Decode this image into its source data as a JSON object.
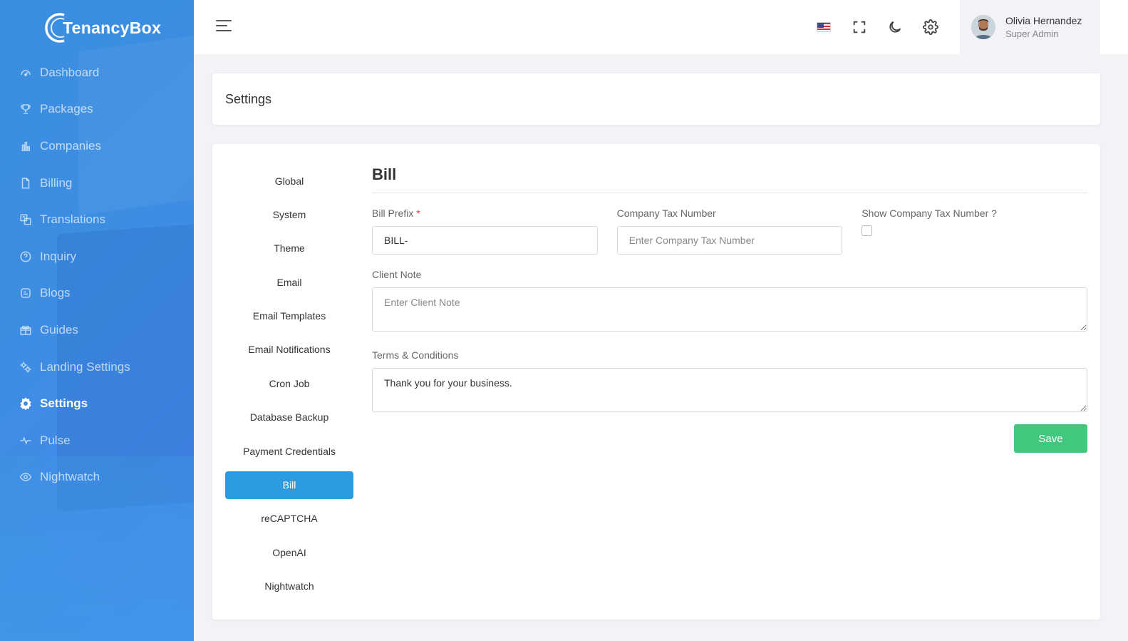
{
  "app": {
    "name": "TenancyBox"
  },
  "sidebar": {
    "items": [
      {
        "label": "Dashboard",
        "icon": "dashboard-icon"
      },
      {
        "label": "Packages",
        "icon": "trophy-icon"
      },
      {
        "label": "Companies",
        "icon": "bar-chart-icon"
      },
      {
        "label": "Billing",
        "icon": "file-icon"
      },
      {
        "label": "Translations",
        "icon": "translate-icon"
      },
      {
        "label": "Inquiry",
        "icon": "question-icon"
      },
      {
        "label": "Blogs",
        "icon": "blog-icon"
      },
      {
        "label": "Guides",
        "icon": "gift-icon"
      },
      {
        "label": "Landing Settings",
        "icon": "cogs-icon"
      },
      {
        "label": "Settings",
        "icon": "gear-icon",
        "active": true
      },
      {
        "label": "Pulse",
        "icon": "pulse-icon"
      },
      {
        "label": "Nightwatch",
        "icon": "eye-icon"
      }
    ]
  },
  "header": {
    "user": {
      "name": "Olivia Hernandez",
      "role": "Super Admin"
    }
  },
  "page": {
    "title": "Settings"
  },
  "tabs": [
    {
      "label": "Global"
    },
    {
      "label": "System"
    },
    {
      "label": "Theme"
    },
    {
      "label": "Email"
    },
    {
      "label": "Email Templates"
    },
    {
      "label": "Email Notifications"
    },
    {
      "label": "Cron Job"
    },
    {
      "label": "Database Backup"
    },
    {
      "label": "Payment Credentials"
    },
    {
      "label": "Bill",
      "active": true
    },
    {
      "label": "reCAPTCHA"
    },
    {
      "label": "OpenAI"
    },
    {
      "label": "Nightwatch"
    }
  ],
  "bill": {
    "heading": "Bill",
    "prefix": {
      "label": "Bill Prefix",
      "required_mark": "*",
      "value": "BILL-"
    },
    "tax_number": {
      "label": "Company Tax Number",
      "placeholder": "Enter Company Tax Number",
      "value": ""
    },
    "show_tax": {
      "label": "Show Company Tax Number ?",
      "checked": false
    },
    "client_note": {
      "label": "Client Note",
      "placeholder": "Enter Client Note",
      "value": ""
    },
    "terms": {
      "label": "Terms & Conditions",
      "value": "Thank you for your business."
    },
    "save_label": "Save"
  },
  "colors": {
    "accent": "#2b9ae0",
    "save": "#41c77e",
    "sidebar": "#3d8de3"
  }
}
